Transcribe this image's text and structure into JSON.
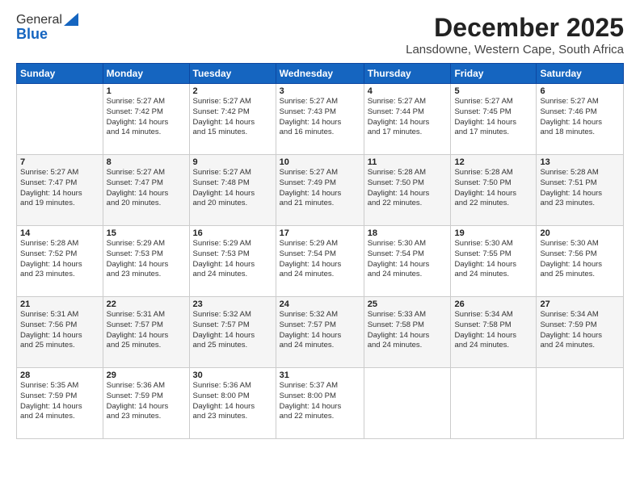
{
  "logo": {
    "general": "General",
    "blue": "Blue"
  },
  "title": {
    "month": "December 2025",
    "location": "Lansdowne, Western Cape, South Africa"
  },
  "header": {
    "days": [
      "Sunday",
      "Monday",
      "Tuesday",
      "Wednesday",
      "Thursday",
      "Friday",
      "Saturday"
    ]
  },
  "weeks": [
    [
      {
        "day": "",
        "info": ""
      },
      {
        "day": "1",
        "info": "Sunrise: 5:27 AM\nSunset: 7:42 PM\nDaylight: 14 hours\nand 14 minutes."
      },
      {
        "day": "2",
        "info": "Sunrise: 5:27 AM\nSunset: 7:42 PM\nDaylight: 14 hours\nand 15 minutes."
      },
      {
        "day": "3",
        "info": "Sunrise: 5:27 AM\nSunset: 7:43 PM\nDaylight: 14 hours\nand 16 minutes."
      },
      {
        "day": "4",
        "info": "Sunrise: 5:27 AM\nSunset: 7:44 PM\nDaylight: 14 hours\nand 17 minutes."
      },
      {
        "day": "5",
        "info": "Sunrise: 5:27 AM\nSunset: 7:45 PM\nDaylight: 14 hours\nand 17 minutes."
      },
      {
        "day": "6",
        "info": "Sunrise: 5:27 AM\nSunset: 7:46 PM\nDaylight: 14 hours\nand 18 minutes."
      }
    ],
    [
      {
        "day": "7",
        "info": "Sunrise: 5:27 AM\nSunset: 7:47 PM\nDaylight: 14 hours\nand 19 minutes."
      },
      {
        "day": "8",
        "info": "Sunrise: 5:27 AM\nSunset: 7:47 PM\nDaylight: 14 hours\nand 20 minutes."
      },
      {
        "day": "9",
        "info": "Sunrise: 5:27 AM\nSunset: 7:48 PM\nDaylight: 14 hours\nand 20 minutes."
      },
      {
        "day": "10",
        "info": "Sunrise: 5:27 AM\nSunset: 7:49 PM\nDaylight: 14 hours\nand 21 minutes."
      },
      {
        "day": "11",
        "info": "Sunrise: 5:28 AM\nSunset: 7:50 PM\nDaylight: 14 hours\nand 22 minutes."
      },
      {
        "day": "12",
        "info": "Sunrise: 5:28 AM\nSunset: 7:50 PM\nDaylight: 14 hours\nand 22 minutes."
      },
      {
        "day": "13",
        "info": "Sunrise: 5:28 AM\nSunset: 7:51 PM\nDaylight: 14 hours\nand 23 minutes."
      }
    ],
    [
      {
        "day": "14",
        "info": "Sunrise: 5:28 AM\nSunset: 7:52 PM\nDaylight: 14 hours\nand 23 minutes."
      },
      {
        "day": "15",
        "info": "Sunrise: 5:29 AM\nSunset: 7:53 PM\nDaylight: 14 hours\nand 23 minutes."
      },
      {
        "day": "16",
        "info": "Sunrise: 5:29 AM\nSunset: 7:53 PM\nDaylight: 14 hours\nand 24 minutes."
      },
      {
        "day": "17",
        "info": "Sunrise: 5:29 AM\nSunset: 7:54 PM\nDaylight: 14 hours\nand 24 minutes."
      },
      {
        "day": "18",
        "info": "Sunrise: 5:30 AM\nSunset: 7:54 PM\nDaylight: 14 hours\nand 24 minutes."
      },
      {
        "day": "19",
        "info": "Sunrise: 5:30 AM\nSunset: 7:55 PM\nDaylight: 14 hours\nand 24 minutes."
      },
      {
        "day": "20",
        "info": "Sunrise: 5:30 AM\nSunset: 7:56 PM\nDaylight: 14 hours\nand 25 minutes."
      }
    ],
    [
      {
        "day": "21",
        "info": "Sunrise: 5:31 AM\nSunset: 7:56 PM\nDaylight: 14 hours\nand 25 minutes."
      },
      {
        "day": "22",
        "info": "Sunrise: 5:31 AM\nSunset: 7:57 PM\nDaylight: 14 hours\nand 25 minutes."
      },
      {
        "day": "23",
        "info": "Sunrise: 5:32 AM\nSunset: 7:57 PM\nDaylight: 14 hours\nand 25 minutes."
      },
      {
        "day": "24",
        "info": "Sunrise: 5:32 AM\nSunset: 7:57 PM\nDaylight: 14 hours\nand 24 minutes."
      },
      {
        "day": "25",
        "info": "Sunrise: 5:33 AM\nSunset: 7:58 PM\nDaylight: 14 hours\nand 24 minutes."
      },
      {
        "day": "26",
        "info": "Sunrise: 5:34 AM\nSunset: 7:58 PM\nDaylight: 14 hours\nand 24 minutes."
      },
      {
        "day": "27",
        "info": "Sunrise: 5:34 AM\nSunset: 7:59 PM\nDaylight: 14 hours\nand 24 minutes."
      }
    ],
    [
      {
        "day": "28",
        "info": "Sunrise: 5:35 AM\nSunset: 7:59 PM\nDaylight: 14 hours\nand 24 minutes."
      },
      {
        "day": "29",
        "info": "Sunrise: 5:36 AM\nSunset: 7:59 PM\nDaylight: 14 hours\nand 23 minutes."
      },
      {
        "day": "30",
        "info": "Sunrise: 5:36 AM\nSunset: 8:00 PM\nDaylight: 14 hours\nand 23 minutes."
      },
      {
        "day": "31",
        "info": "Sunrise: 5:37 AM\nSunset: 8:00 PM\nDaylight: 14 hours\nand 22 minutes."
      },
      {
        "day": "",
        "info": ""
      },
      {
        "day": "",
        "info": ""
      },
      {
        "day": "",
        "info": ""
      }
    ]
  ]
}
